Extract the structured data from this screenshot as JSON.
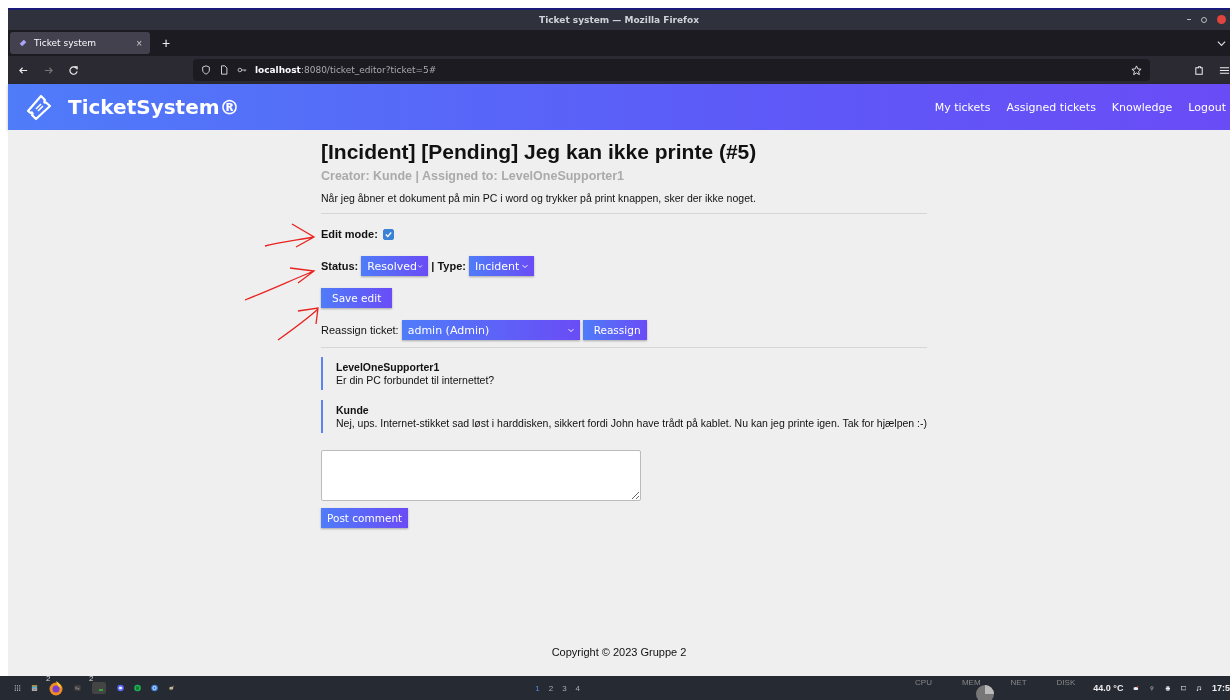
{
  "window": {
    "title": "Ticket system — Mozilla Firefox"
  },
  "tab": {
    "label": "Ticket system",
    "close": "×",
    "new_tab": "+"
  },
  "url": {
    "host": "localhost",
    "path": ":8080/ticket_editor?ticket=5#"
  },
  "site": {
    "brand": "TicketSystem®",
    "nav": [
      "My tickets",
      "Assigned tickets",
      "Knowledge",
      "Logout"
    ]
  },
  "ticket": {
    "title": "[Incident] [Pending] Jeg kan ikke printe (#5)",
    "meta": "Creator: Kunde | Assigned to: LevelOneSupporter1",
    "description": "Når jeg åbner et dokument på min PC i word og trykker på print knappen, sker der ikke noget."
  },
  "edit_mode": {
    "label": "Edit mode:",
    "checked": true
  },
  "status": {
    "label": "Status:",
    "value": "Resolved"
  },
  "type": {
    "label": "| Type:",
    "value": "Incident"
  },
  "save_button": "Save edit",
  "reassign": {
    "label": "Reassign ticket:",
    "value": "admin (Admin)",
    "button": "Reassign"
  },
  "comments": [
    {
      "author": "LevelOneSupporter1",
      "text": "Er din PC forbundet til internettet?"
    },
    {
      "author": "Kunde",
      "text": "Nej, ups. Internet-stikket sad løst i harddisken, sikkert fordi John have trådt på kablet. Nu kan jeg printe igen. Tak for hjælpen :-)"
    }
  ],
  "post_button": "Post comment",
  "footer": "Copyright © 2023 Gruppe 2",
  "taskbar": {
    "badges": [
      "2",
      "2"
    ],
    "workspaces": [
      {
        "label": "1",
        "selected": true
      },
      {
        "label": "2",
        "selected": false
      },
      {
        "label": "3",
        "selected": false
      },
      {
        "label": "4",
        "selected": false
      }
    ],
    "monitors": [
      "CPU",
      "MEM",
      "NET",
      "DISK"
    ],
    "temperature": "44.0 °C",
    "clock": "17:5"
  }
}
